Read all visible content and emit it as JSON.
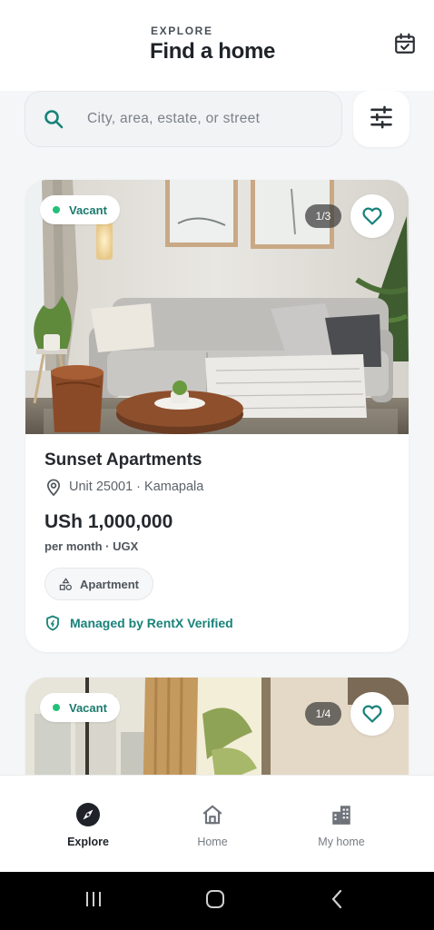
{
  "header": {
    "eyebrow": "EXPLORE",
    "title": "Find a home",
    "calendar_icon": "calendar-check-icon"
  },
  "search": {
    "placeholder": "City, area, estate, or street",
    "icon": "search-icon",
    "filter_icon": "sliders-icon"
  },
  "colors": {
    "accent": "#1a7a6d",
    "vacant_dot": "#24c07a",
    "background": "#f4f6f8"
  },
  "listings": [
    {
      "status": "Vacant",
      "photo_counter": "1/3",
      "name": "Sunset Apartments",
      "location": "Unit 25001 · Kamapala",
      "price": "USh 1,000,000",
      "period": "per month · UGX",
      "type": "Apartment",
      "managed": "Managed by RentX Verified"
    },
    {
      "status": "Vacant",
      "photo_counter": "1/4"
    }
  ],
  "tabbar": {
    "items": [
      {
        "label": "Explore",
        "icon": "compass-icon",
        "active": true
      },
      {
        "label": "Home",
        "icon": "house-icon",
        "active": false
      },
      {
        "label": "My home",
        "icon": "building-icon",
        "active": false
      }
    ]
  },
  "system_nav": {
    "recents_icon": "recents-icon",
    "home_icon": "home-circle-icon",
    "back_icon": "back-icon"
  }
}
